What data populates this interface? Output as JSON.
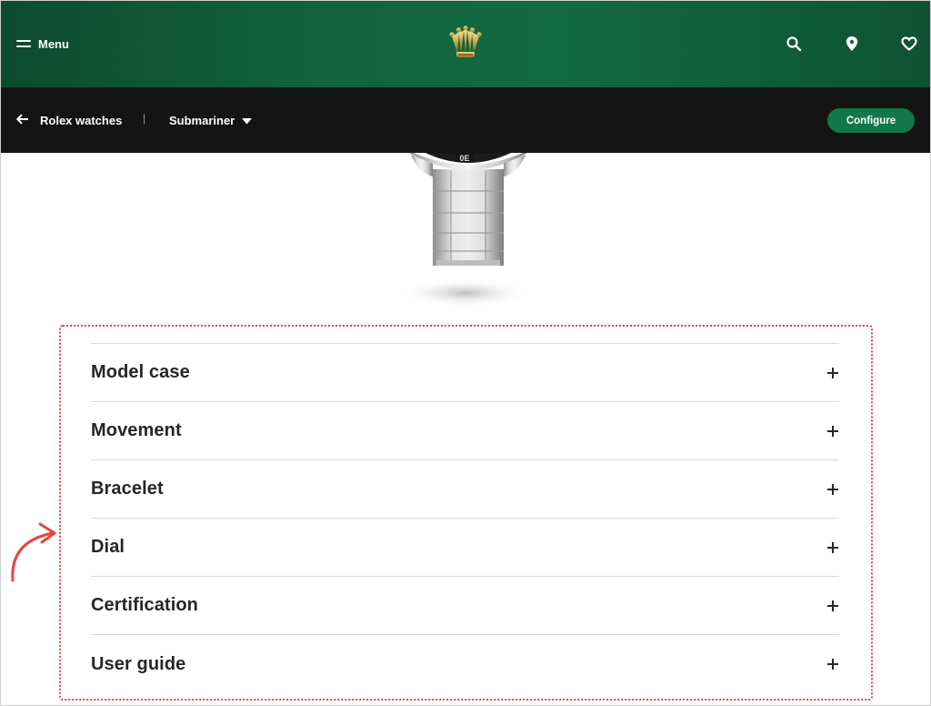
{
  "header": {
    "menu_label": "Menu",
    "logo_icon": "crown-logo-icon",
    "icons": [
      "search-icon",
      "location-pin-icon",
      "heart-icon"
    ],
    "colors": {
      "header_green": "#12633e",
      "accent_green": "#127749",
      "subnav_bg": "#141414"
    }
  },
  "subnav": {
    "back_label": "Rolex watches",
    "separator": "|",
    "collection": "Submariner",
    "configure_label": "Configure"
  },
  "specs": {
    "items": [
      {
        "label": "Model case"
      },
      {
        "label": "Movement"
      },
      {
        "label": "Bracelet"
      },
      {
        "label": "Dial"
      },
      {
        "label": "Certification"
      },
      {
        "label": "User guide"
      }
    ],
    "highlight_color": "#e5463d"
  }
}
